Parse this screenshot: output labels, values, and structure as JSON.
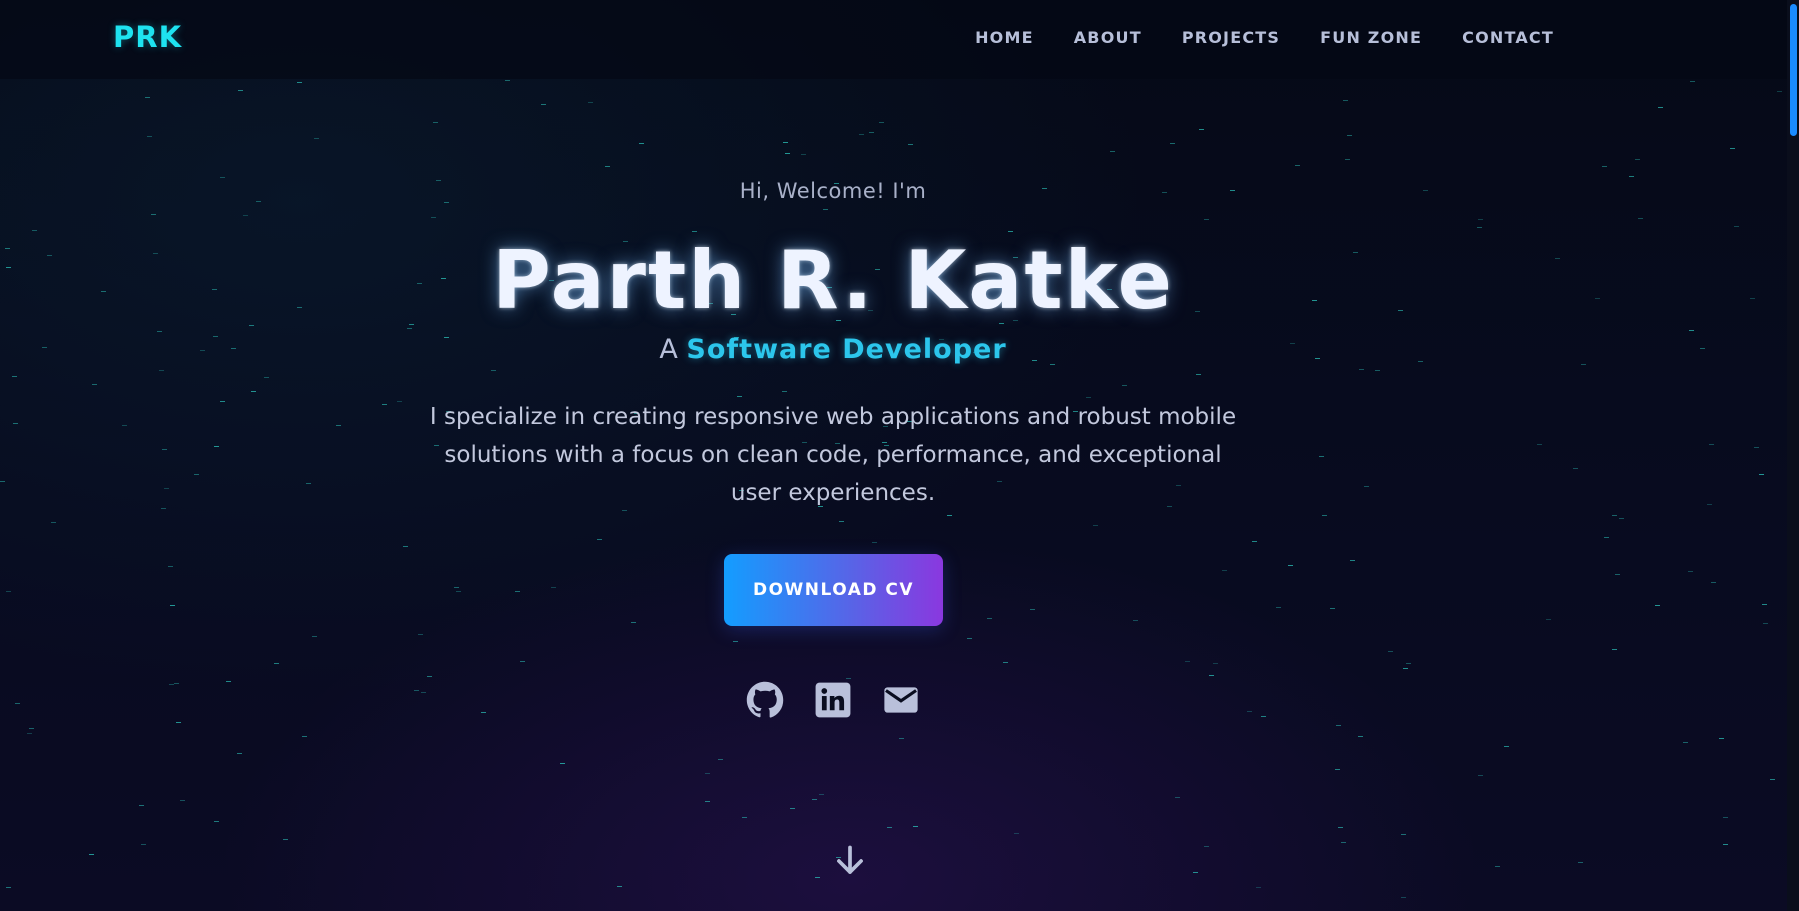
{
  "navbar": {
    "logo": "PRK",
    "links": [
      "HOME",
      "ABOUT",
      "PROJECTS",
      "FUN ZONE",
      "CONTACT"
    ]
  },
  "hero": {
    "greeting": "Hi, Welcome! I'm",
    "name": "Parth R. Katke",
    "role_prefix": "A",
    "role": "Software Developer",
    "bio": "I specialize in creating responsive web applications and robust mobile solutions with a focus on clean code, performance, and exceptional user experiences.",
    "cta_label": "DOWNLOAD CV"
  },
  "socials": [
    {
      "name": "github-icon"
    },
    {
      "name": "linkedin-icon"
    },
    {
      "name": "email-icon"
    }
  ],
  "icons": {
    "scroll_down": "arrow-down-icon"
  },
  "colors": {
    "accent_cyan": "#1ee3f0",
    "role_color": "#2cc6ec",
    "button_gradient_start": "#139dff",
    "button_gradient_end": "#8a38df",
    "background": "#060a1a",
    "scrollbar_thumb": "#1a8bff"
  }
}
